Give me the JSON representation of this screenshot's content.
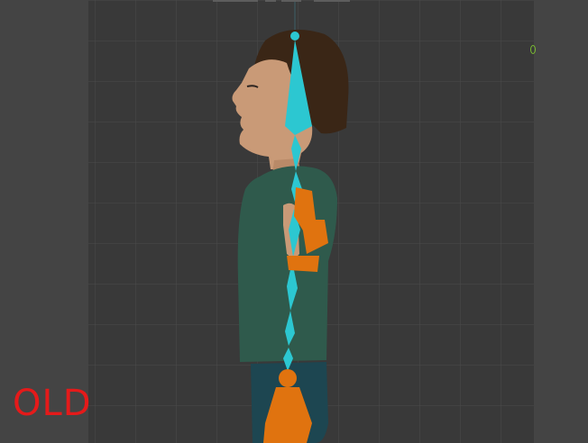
{
  "overlay": {
    "label": "OLD",
    "label_color": "#e51a1a"
  },
  "colors": {
    "background": "#3d3d3d",
    "viewport_bg": "#393939",
    "grid": "#4a4a4a",
    "bone_selected": "#2cc7d1",
    "bone_deselected": "#e0730f",
    "shirt": "#2f5a4c",
    "skin": "#c99a77",
    "hair": "#3a2616",
    "pants": "#1d4651",
    "gizmo": "#7bbf30"
  },
  "icons": [
    "armature-bones",
    "character-mesh",
    "viewport-grid",
    "axis-gizmo"
  ]
}
